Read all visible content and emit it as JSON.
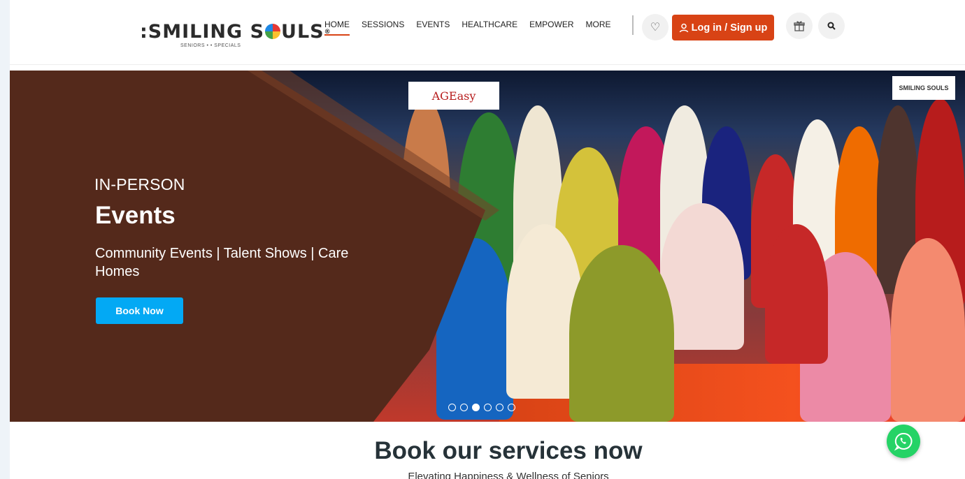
{
  "brand": {
    "name": "SMILING SOULS",
    "tagline": "SENIORS • • SPECIALS"
  },
  "nav": {
    "items": [
      {
        "label": "HOME",
        "active": true
      },
      {
        "label": "SESSIONS"
      },
      {
        "label": "EVENTS"
      },
      {
        "label": "HEALTHCARE"
      },
      {
        "label": "EMPOWER"
      },
      {
        "label": "MORE"
      }
    ],
    "login_label": "Log in / Sign up",
    "wishlist_icon": "heart-icon",
    "gift_icon": "gift-icon",
    "search_icon": "search-icon"
  },
  "hero": {
    "kicker": "IN-PERSON",
    "title": "Events",
    "text": "Community Events | Talent Shows | Care Homes",
    "button_label": "Book Now",
    "sign_left": "AGEasy",
    "sign_right": "SMILING SOULS",
    "slides_total": 6,
    "slide_active": 3
  },
  "section": {
    "title": "Book our services now",
    "subtitle": "Elevating Happiness & Wellness of Seniors"
  },
  "colors": {
    "accent": "#d84315",
    "button_blue": "#03a9f4",
    "panel": "#54291b",
    "whatsapp": "#25d366"
  }
}
